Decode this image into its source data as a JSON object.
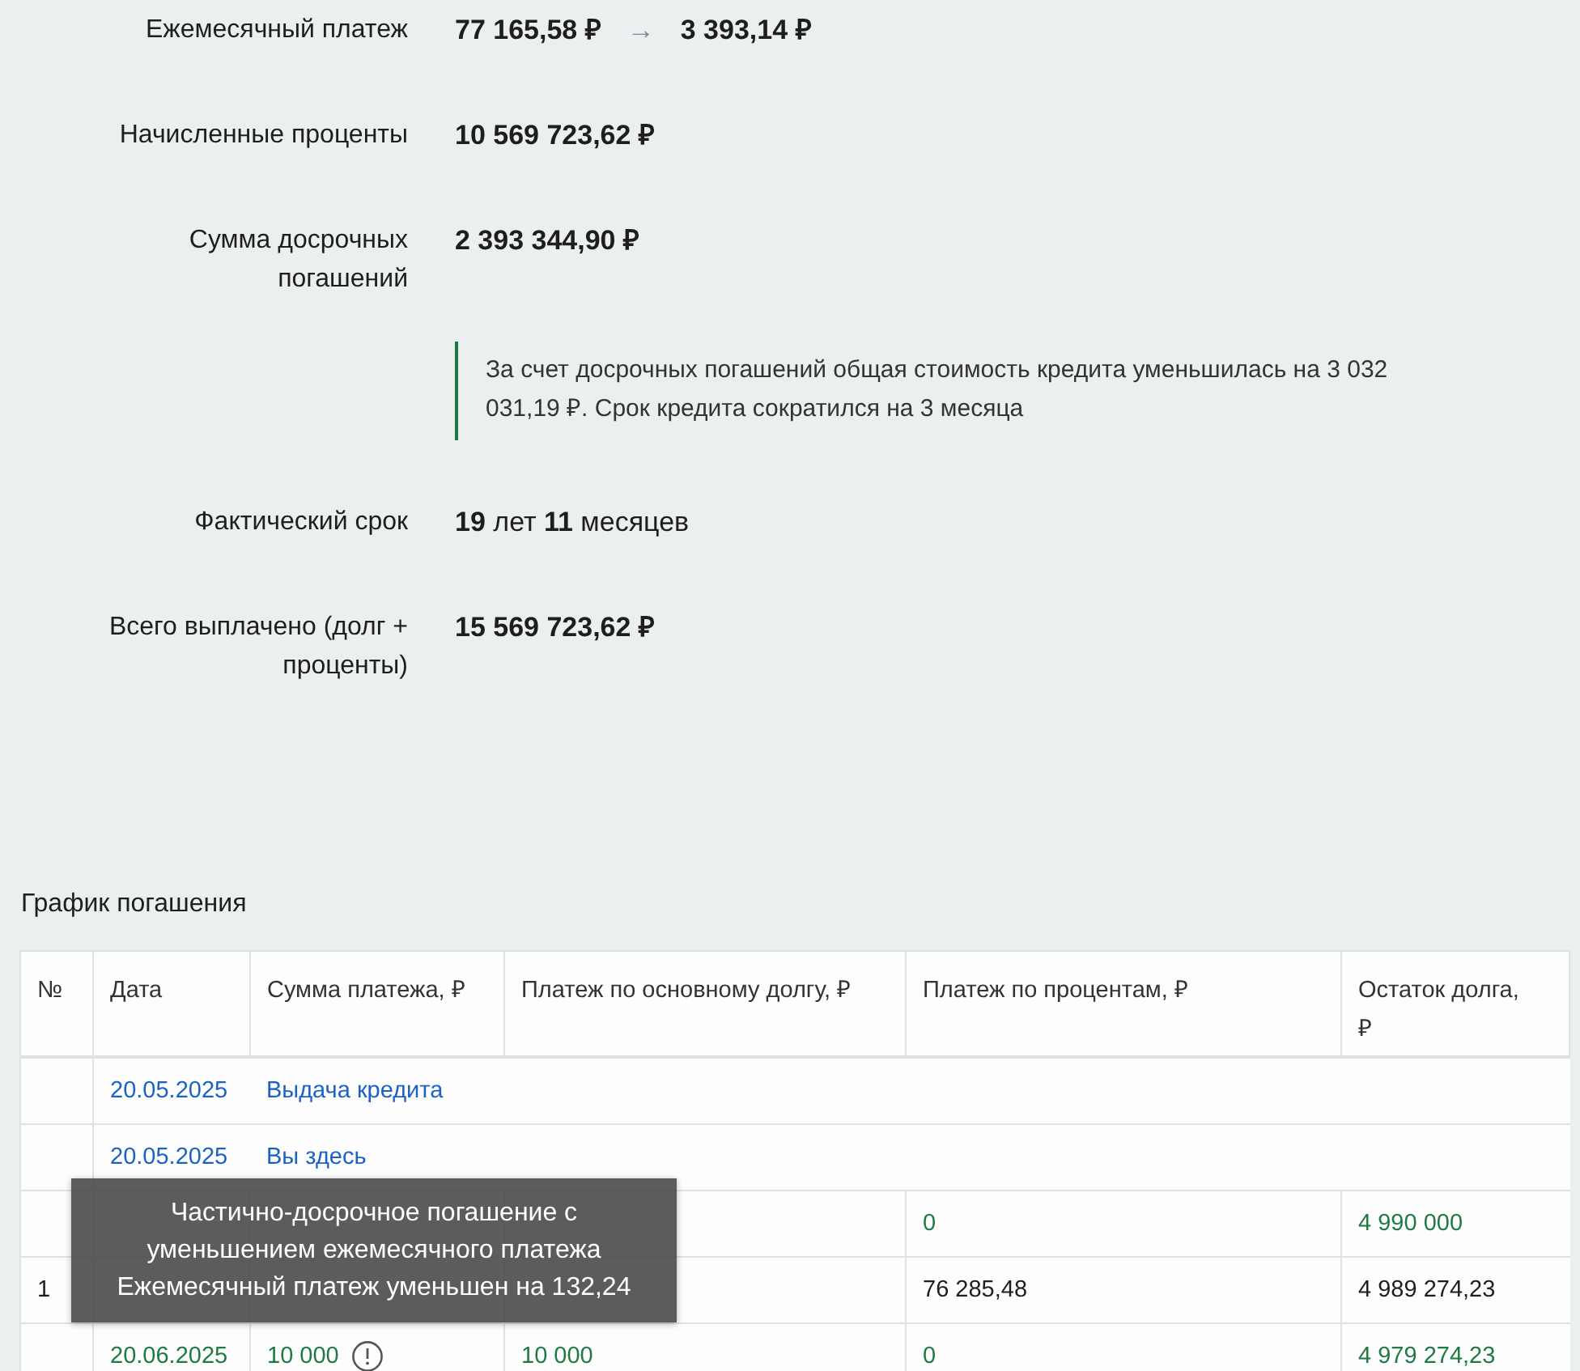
{
  "summary": [
    {
      "kind": "change",
      "label": "Ежемесячный платеж",
      "value": "77 165,58 ₽",
      "arrow": "→",
      "new_value": "3 393,14 ₽"
    },
    {
      "kind": "amount",
      "label": "Начисленные проценты",
      "value": "10 569 723,62 ₽"
    },
    {
      "kind": "amount",
      "label": "Сумма досрочных погашений",
      "value": "2 393 344,90 ₽"
    },
    {
      "kind": "note",
      "text": "За счет досрочных погашений общая стоимость кредита уменьшилась на 3 032 031,19 ₽. Срок кредита сократился на 3 месяца"
    },
    {
      "kind": "term",
      "label": "Фактический срок",
      "value": "**19** лет **11** месяцев"
    },
    {
      "kind": "amount",
      "label": "Всего выплачено (долг + проценты)",
      "value": "15 569 723,62 ₽"
    }
  ],
  "schedule": {
    "title": "График погашения",
    "columns": [
      "№",
      "Дата",
      "Сумма платежа, ₽",
      "Платеж по основному долгу, ₽",
      "Платеж по процентам, ₽",
      "Остаток долга, ₽"
    ],
    "rows": [
      {
        "kind": "event",
        "date": "20.05.2025",
        "text": "Выдача кредита"
      },
      {
        "kind": "event",
        "date": "20.05.2025",
        "text": "Вы здесь"
      },
      {
        "kind": "early",
        "interest": "0",
        "balance": "4 990 000"
      },
      {
        "kind": "payment",
        "number": "1",
        "interest": "76 285,48",
        "balance": "4 989 274,23"
      },
      {
        "kind": "early",
        "date": "20.06.2025",
        "amount": "10 000",
        "info_icon": true,
        "principal": "10 000",
        "interest": "0",
        "balance": "4 979 274,23"
      }
    ]
  },
  "tooltip": {
    "lines": [
      "Частично-досрочное погашение с",
      "уменьшением ежемесячного платежа",
      "Ежемесячный платеж уменьшен на 132,24"
    ]
  }
}
